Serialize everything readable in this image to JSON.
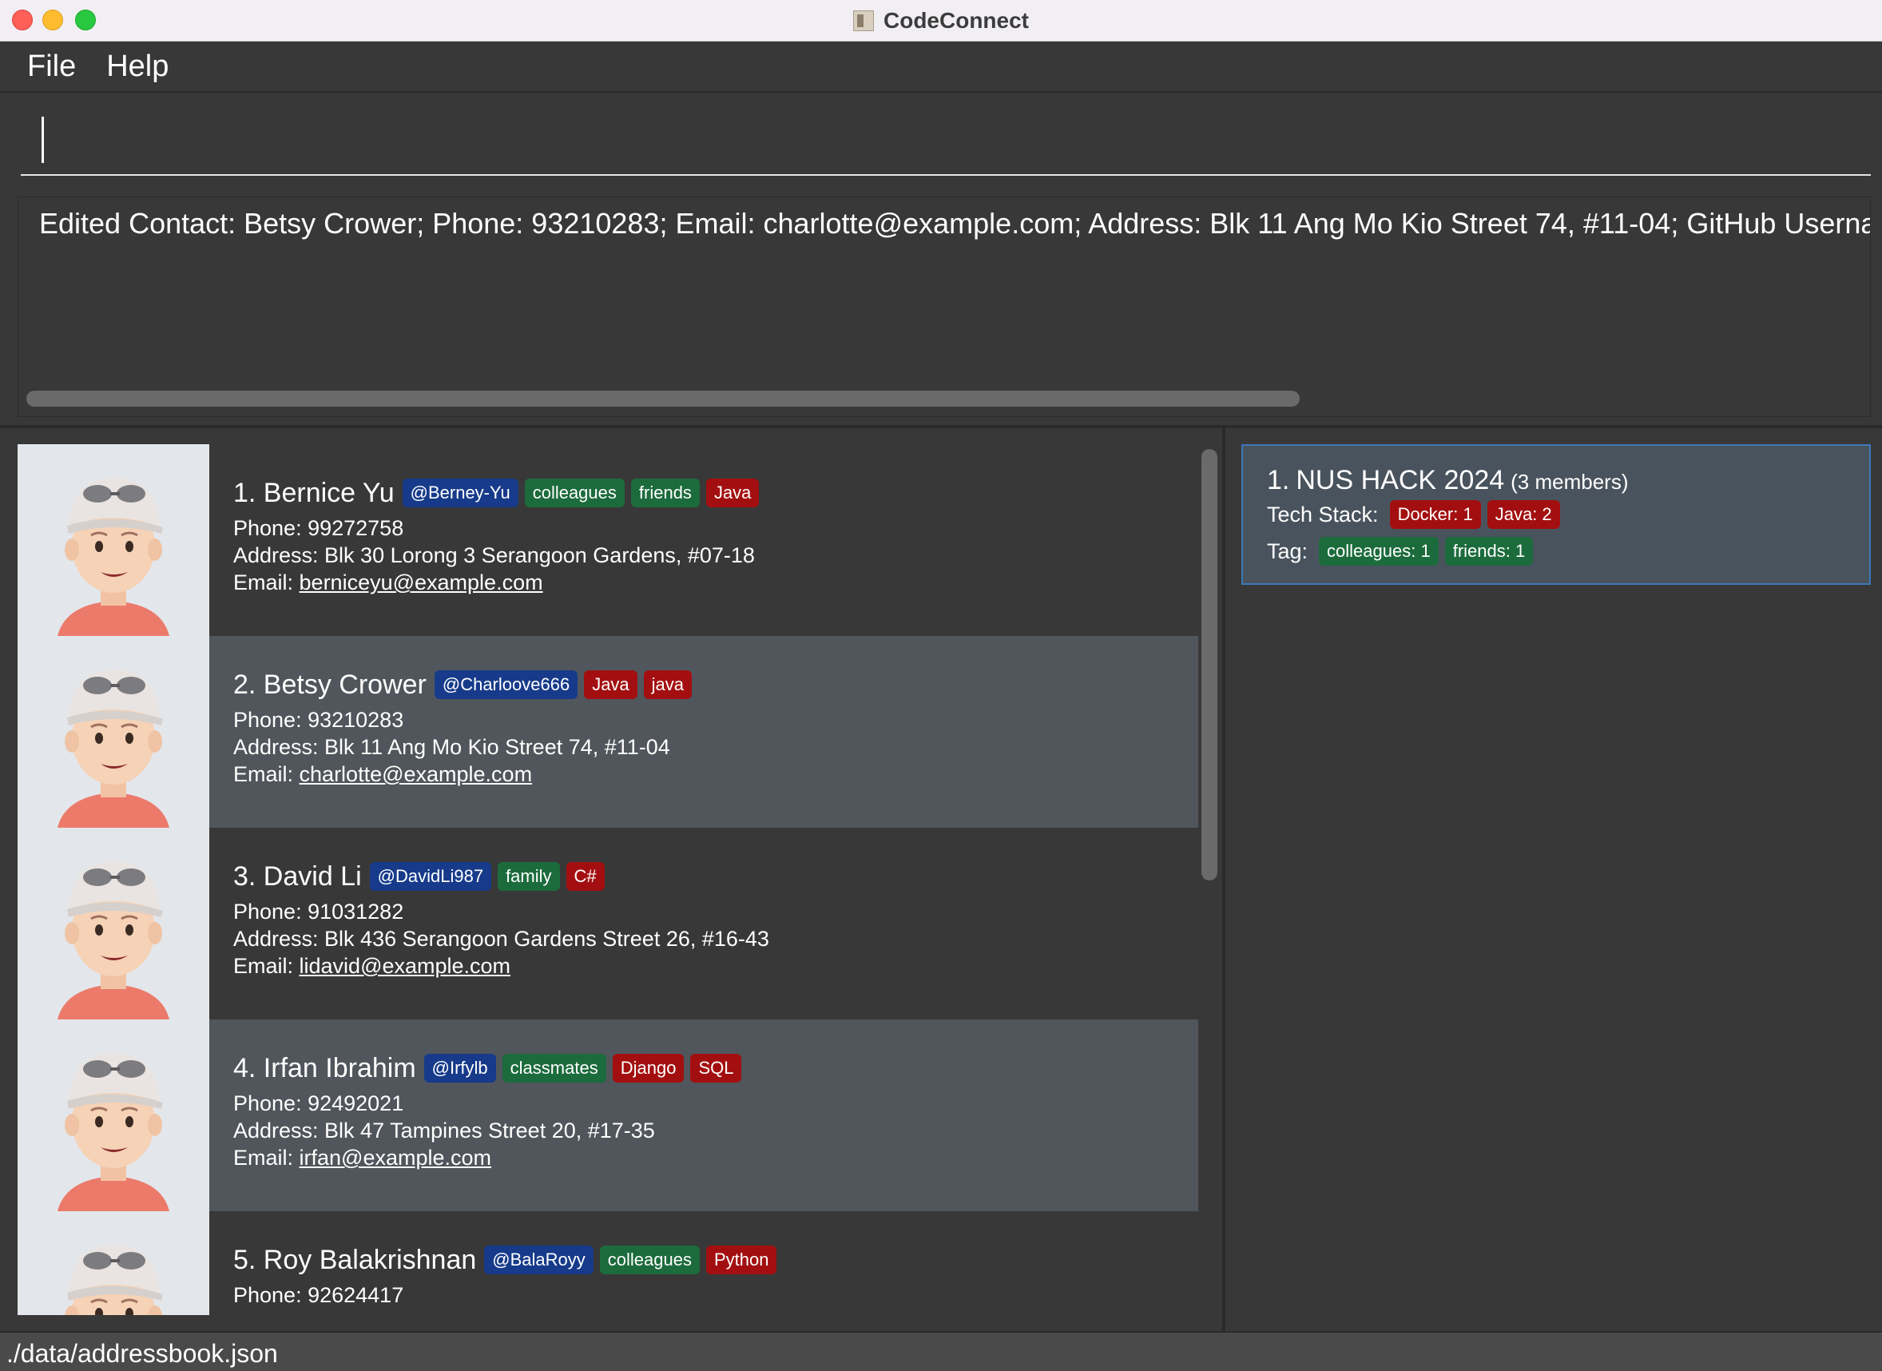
{
  "window": {
    "title": "CodeConnect"
  },
  "menu": {
    "file": "File",
    "help": "Help"
  },
  "command": {
    "value": "",
    "placeholder": ""
  },
  "result": {
    "text": "Edited Contact: Betsy Crower; Phone: 93210283; Email: charlotte@example.com; Address: Blk 11 Ang Mo Kio Street 74, #11-04; GitHub Username:"
  },
  "persons": [
    {
      "index": "1.",
      "name": "Bernice Yu",
      "github": "@Berney-Yu",
      "tags": [
        "colleagues",
        "friends"
      ],
      "tech": [
        "Java"
      ],
      "phone": "Phone: 99272758",
      "address": "Address: Blk 30 Lorong 3 Serangoon Gardens, #07-18",
      "email_label": "Email: ",
      "email": "berniceyu@example.com"
    },
    {
      "index": "2.",
      "name": "Betsy Crower",
      "github": "@Charloove666",
      "tags": [],
      "tech": [
        "Java",
        "java"
      ],
      "phone": "Phone: 93210283",
      "address": "Address: Blk 11 Ang Mo Kio Street 74, #11-04",
      "email_label": "Email: ",
      "email": "charlotte@example.com"
    },
    {
      "index": "3.",
      "name": "David Li",
      "github": "@DavidLi987",
      "tags": [
        "family"
      ],
      "tech": [
        "C#"
      ],
      "phone": "Phone: 91031282",
      "address": "Address: Blk 436 Serangoon Gardens Street 26, #16-43",
      "email_label": "Email: ",
      "email": "lidavid@example.com"
    },
    {
      "index": "4.",
      "name": "Irfan Ibrahim",
      "github": "@Irfylb",
      "tags": [
        "classmates"
      ],
      "tech": [
        "Django",
        "SQL"
      ],
      "phone": "Phone: 92492021",
      "address": "Address: Blk 47 Tampines Street 20, #17-35",
      "email_label": "Email: ",
      "email": "irfan@example.com"
    },
    {
      "index": "5.",
      "name": "Roy Balakrishnan",
      "github": "@BalaRoyy",
      "tags": [
        "colleagues"
      ],
      "tech": [
        "Python"
      ],
      "phone": "Phone: 92624417",
      "address": "",
      "email_label": "",
      "email": ""
    }
  ],
  "group": {
    "index": "1.",
    "name": "NUS HACK 2024",
    "members": "(3 members)",
    "tech_label": "Tech Stack:",
    "tech": [
      "Docker: 1",
      "Java: 2"
    ],
    "tag_label": "Tag:",
    "tags": [
      "colleagues: 1",
      "friends: 1"
    ]
  },
  "status": {
    "path": "./data/addressbook.json"
  },
  "colors": {
    "github_badge": "#173b8a",
    "tag_badge": "#1c6b3c",
    "tech_badge": "#a30f10",
    "selected_border": "#3c78b8"
  }
}
